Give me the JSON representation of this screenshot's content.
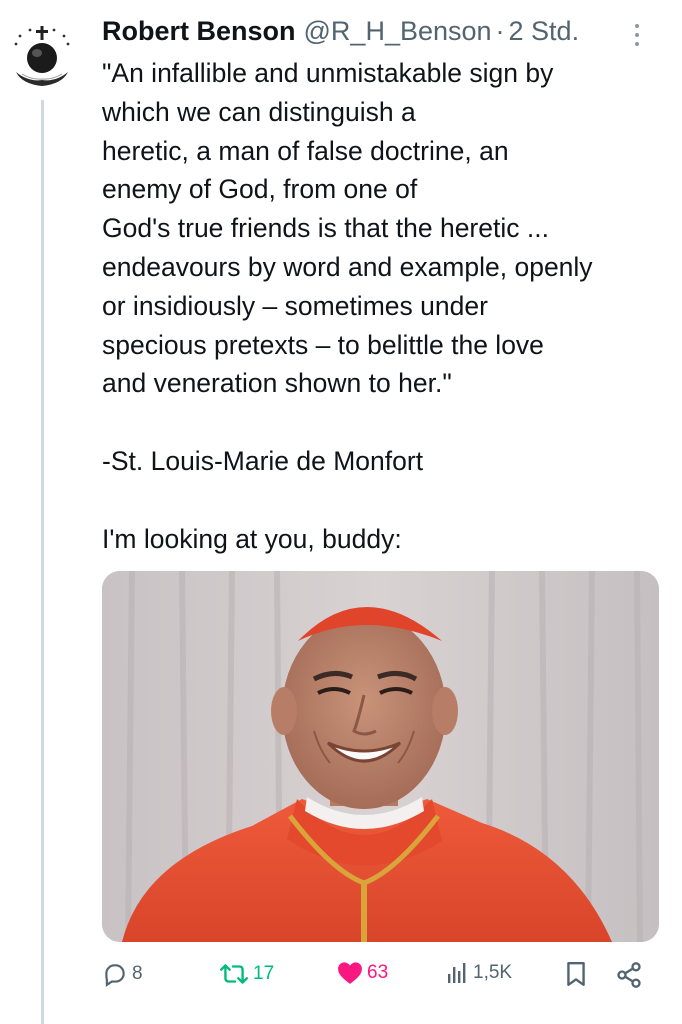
{
  "author": {
    "name": "Robert Benson",
    "handle": "@R_H_Benson",
    "separator": "·",
    "time": "2 Std."
  },
  "tweet": {
    "lines": [
      "\"An infallible and unmistakable sign by",
      "which we can distinguish a",
      "heretic, a man of false doctrine, an",
      "enemy of God, from one of",
      "God's true friends is that the heretic ...",
      "endeavours by word and example, openly",
      "or insidiously – sometimes under",
      "specious pretexts – to belittle the love",
      "and veneration shown to her.\""
    ],
    "attribution": "-St. Louis-Marie de Monfort",
    "comment": "I'm looking at you, buddy:"
  },
  "actions": {
    "replies": "8",
    "reposts": "17",
    "likes": "63",
    "views": "1,5K"
  },
  "colors": {
    "text": "#0f1419",
    "secondary": "#536471",
    "repost_active": "#00ba7c",
    "like_active": "#f91880",
    "thread_line": "#cfd9de"
  },
  "icons": [
    "more-icon",
    "reply-icon",
    "repost-icon",
    "like-icon",
    "views-icon",
    "bookmark-icon",
    "share-icon"
  ]
}
